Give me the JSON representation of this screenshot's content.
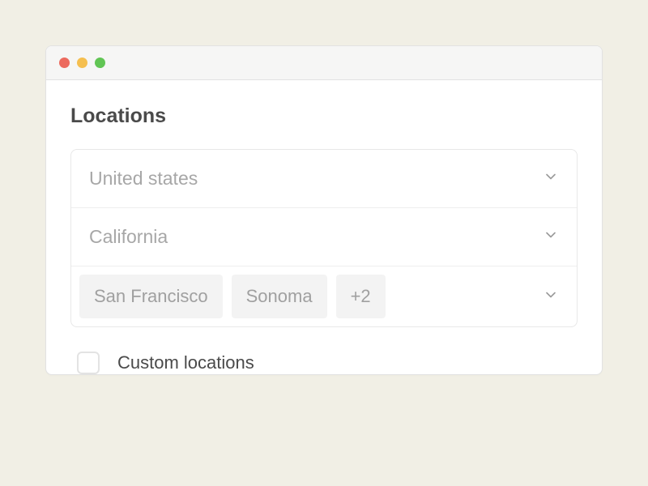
{
  "section": {
    "title": "Locations"
  },
  "country": {
    "label": "United states"
  },
  "state": {
    "label": "California"
  },
  "cities": {
    "chips": [
      "San Francisco",
      "Sonoma"
    ],
    "overflow": "+2"
  },
  "custom": {
    "label": "Custom locations",
    "checked": false
  }
}
